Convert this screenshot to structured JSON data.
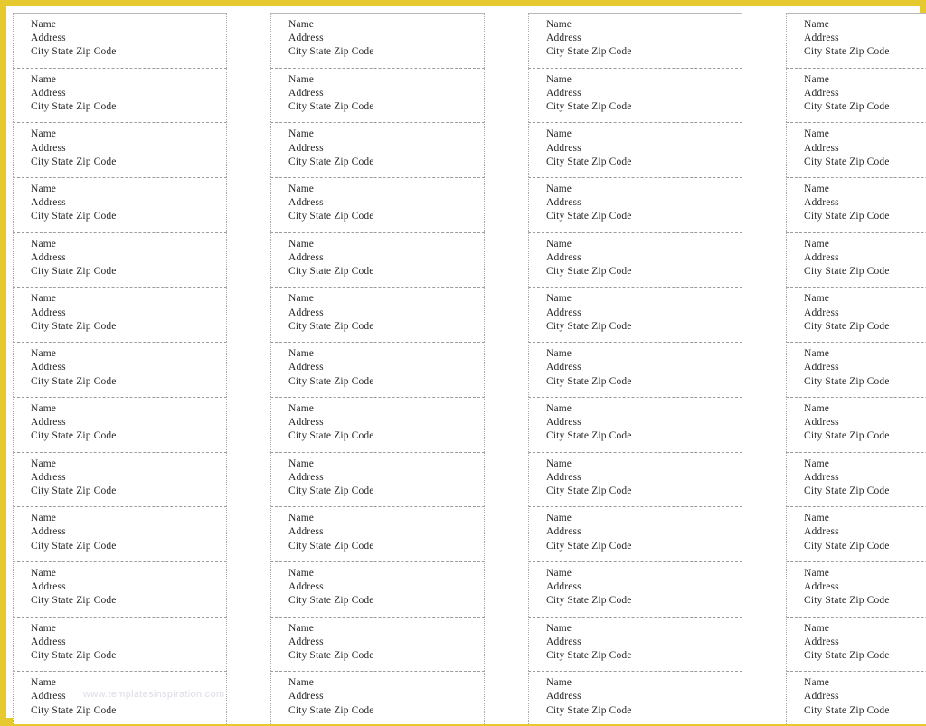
{
  "document": {
    "kind": "mailing-label-sheet-template",
    "page_background": "#ffffff",
    "frame_color": "#e6c92e",
    "label_border_color": "#9c9c9c",
    "text_color": "#28282a",
    "columns": 4,
    "rows": 13,
    "total_labels": 52
  },
  "label_template": {
    "line1": "Name",
    "line2": "Address",
    "line3": "City State  Zip Code"
  },
  "watermark": {
    "text": "www.templatesinspiration.com"
  },
  "labels": [
    {
      "line1": "Name",
      "line2": "Address",
      "line3": "City State  Zip Code"
    },
    {
      "line1": "Name",
      "line2": "Address",
      "line3": "City State  Zip Code"
    },
    {
      "line1": "Name",
      "line2": "Address",
      "line3": "City State  Zip Code"
    },
    {
      "line1": "Name",
      "line2": "Address",
      "line3": "City State  Zip Code"
    },
    {
      "line1": "Name",
      "line2": "Address",
      "line3": "City State  Zip Code"
    },
    {
      "line1": "Name",
      "line2": "Address",
      "line3": "City State  Zip Code"
    },
    {
      "line1": "Name",
      "line2": "Address",
      "line3": "City State  Zip Code"
    },
    {
      "line1": "Name",
      "line2": "Address",
      "line3": "City State  Zip Code"
    },
    {
      "line1": "Name",
      "line2": "Address",
      "line3": "City State  Zip Code"
    },
    {
      "line1": "Name",
      "line2": "Address",
      "line3": "City State  Zip Code"
    },
    {
      "line1": "Name",
      "line2": "Address",
      "line3": "City State  Zip Code"
    },
    {
      "line1": "Name",
      "line2": "Address",
      "line3": "City State  Zip Code"
    },
    {
      "line1": "Name",
      "line2": "Address",
      "line3": "City State  Zip Code"
    }
  ]
}
